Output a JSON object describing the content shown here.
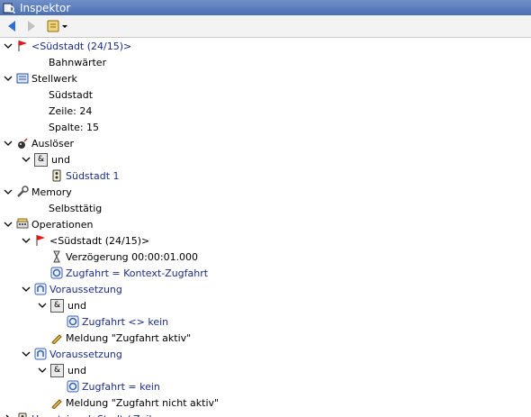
{
  "window": {
    "title": "Inspektor"
  },
  "tree": [
    {
      "text": "<Südstadt (24/15)>",
      "level": 0,
      "icon": "flag-icon",
      "expand": true,
      "ref": true
    },
    {
      "text": "Bahnwärter",
      "level": 1
    },
    {
      "text": "Stellwerk",
      "level": 0,
      "icon": "panel-icon",
      "expand": true
    },
    {
      "text": "Südstadt",
      "level": 1
    },
    {
      "text": "Zeile: 24",
      "level": 1
    },
    {
      "text": "Spalte: 15",
      "level": 1
    },
    {
      "text": "Auslöser",
      "level": 0,
      "icon": "bomb-icon",
      "expand": true
    },
    {
      "text": "und",
      "level": 1,
      "icon": "and-icon",
      "expand": true
    },
    {
      "text": "Südstadt 1",
      "level": 2,
      "icon": "signal-icon",
      "ref": true
    },
    {
      "text": "Memory",
      "level": 0,
      "icon": "wrench-icon",
      "expand": true
    },
    {
      "text": "Selbsttätig",
      "level": 1
    },
    {
      "text": "Operationen",
      "level": 0,
      "icon": "keyboard-icon",
      "expand": true
    },
    {
      "text": "<Südstadt (24/15)>",
      "level": 1,
      "icon": "flag-icon",
      "expand": true
    },
    {
      "text": "Verzögerung 00:00:01.000",
      "level": 2,
      "icon": "hourglass-icon"
    },
    {
      "text": "Zugfahrt = Kontext-Zugfahrt",
      "level": 2,
      "icon": "route-icon",
      "ref": true
    },
    {
      "text": "Voraussetzung",
      "level": 1,
      "icon": "condition-icon",
      "expand": true,
      "ref": true
    },
    {
      "text": "und",
      "level": 2,
      "icon": "and-icon",
      "expand": true
    },
    {
      "text": "Zugfahrt <> kein",
      "level": 3,
      "icon": "route-icon",
      "ref": true
    },
    {
      "text": "Meldung \"Zugfahrt aktiv\"",
      "level": 2,
      "icon": "pencil-icon"
    },
    {
      "text": "Voraussetzung",
      "level": 1,
      "icon": "condition-icon",
      "expand": true,
      "ref": true
    },
    {
      "text": "und",
      "level": 2,
      "icon": "and-icon",
      "expand": true
    },
    {
      "text": "Zugfahrt = kein",
      "level": 3,
      "icon": "route-icon",
      "ref": true
    },
    {
      "text": "Meldung \"Zugfahrt nicht aktiv\"",
      "level": 2,
      "icon": "pencil-icon"
    },
    {
      "text": "Hauptsignal: Stadt / Zeil ...",
      "level": 0,
      "icon": "signal-icon",
      "expand": false,
      "ref": true
    }
  ]
}
